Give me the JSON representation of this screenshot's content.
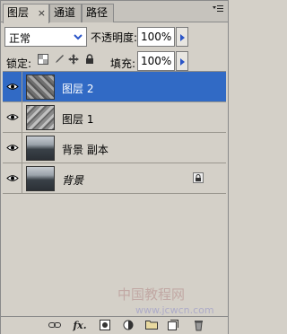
{
  "tabs": [
    {
      "label": "图层",
      "active": true
    },
    {
      "label": "通道",
      "active": false
    },
    {
      "label": "路径",
      "active": false
    }
  ],
  "tab_close_glyph": "×",
  "blend_mode": {
    "value": "正常"
  },
  "opacity": {
    "label": "不透明度:",
    "value": "100%"
  },
  "lock": {
    "label": "锁定:"
  },
  "fill": {
    "label": "填充:",
    "value": "100%"
  },
  "layers": [
    {
      "name": "图层 2",
      "selected": true,
      "visible": true,
      "locked": false,
      "italic": false,
      "thumb": "texture"
    },
    {
      "name": "图层 1",
      "selected": false,
      "visible": true,
      "locked": false,
      "italic": false,
      "thumb": "texture"
    },
    {
      "name": "背景 副本",
      "selected": false,
      "visible": true,
      "locked": false,
      "italic": false,
      "thumb": "photo"
    },
    {
      "name": "背景",
      "selected": false,
      "visible": true,
      "locked": true,
      "italic": true,
      "thumb": "photo"
    }
  ],
  "footer": {
    "fx_label": "fx."
  },
  "watermark": {
    "text": "中国教程网",
    "url": "www.jcwcn.com"
  },
  "colors": {
    "selected_row": "#316ac5",
    "panel_bg": "#d4d0c8"
  }
}
